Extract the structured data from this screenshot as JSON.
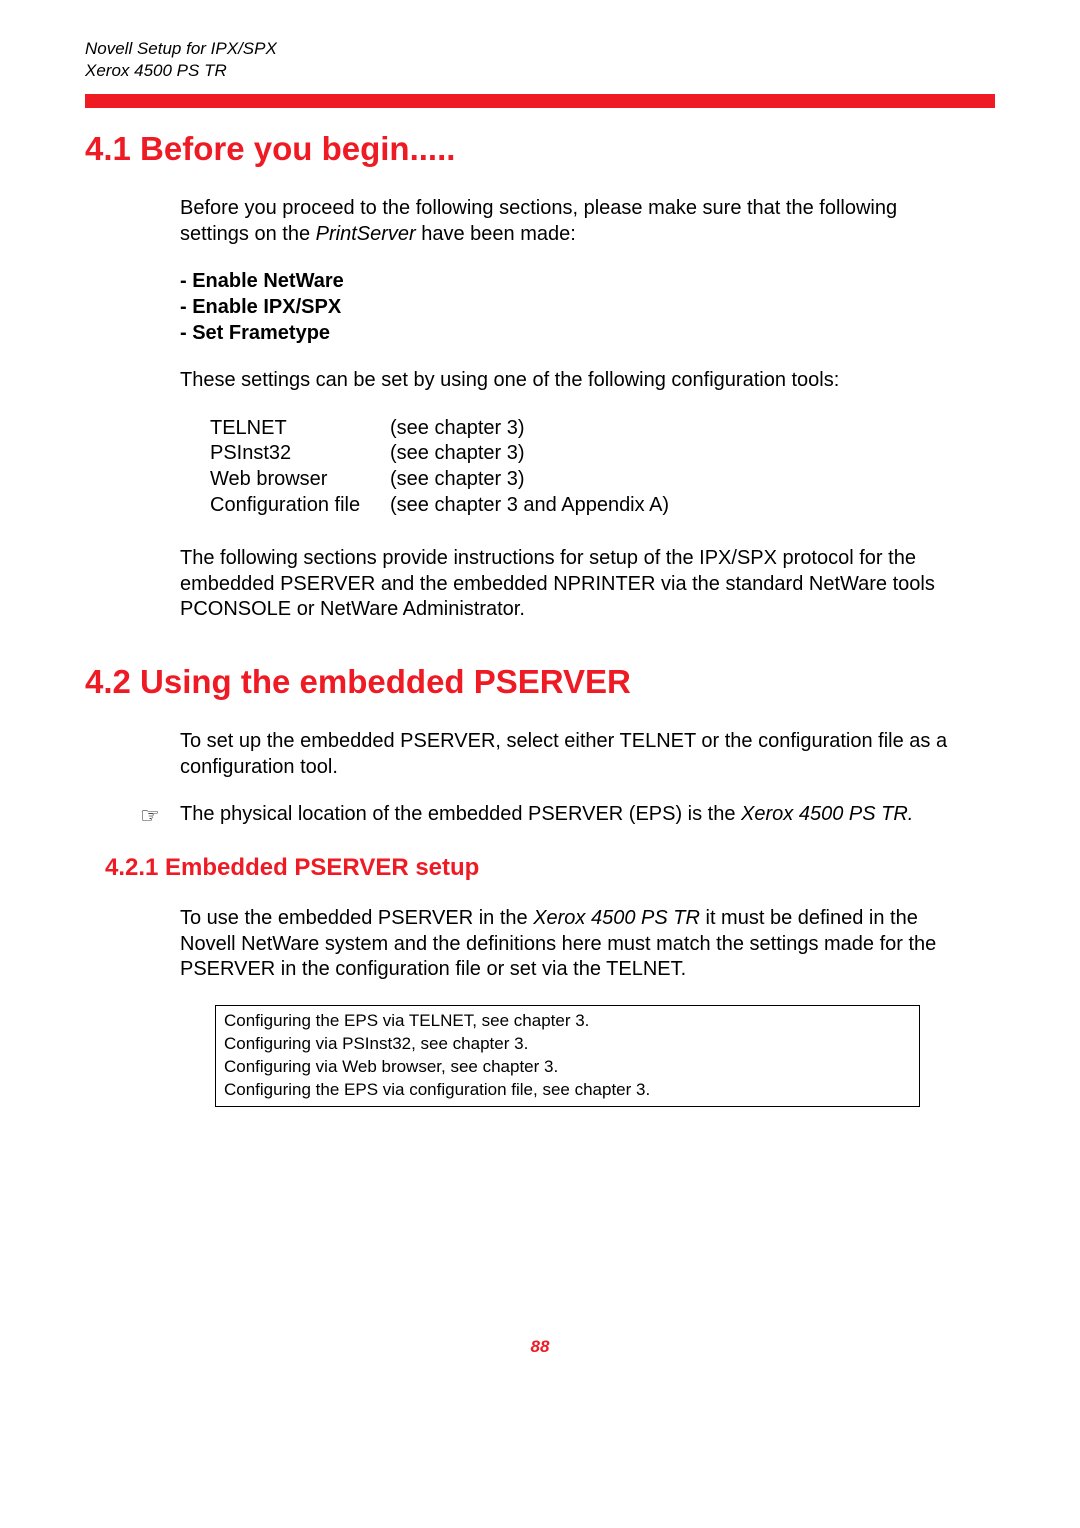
{
  "header": {
    "line1": "Novell Setup for IPX/SPX",
    "line2": "Xerox 4500 PS TR"
  },
  "sec41": {
    "title": "4.1 Before you begin.....",
    "intro_a": "Before you proceed to the following sections, please make sure that the following settings on the ",
    "intro_em": "PrintServer",
    "intro_b": " have been made:",
    "bullets": {
      "b1": "- Enable NetWare",
      "b2": "- Enable IPX/SPX",
      "b3": "- Set Frametype"
    },
    "tools_intro": "These settings can be set by using one of the following configuration tools:",
    "tools": [
      {
        "name": "TELNET",
        "ref": "(see chapter 3)"
      },
      {
        "name": "PSInst32",
        "ref": "(see chapter 3)"
      },
      {
        "name": "Web browser",
        "ref": "(see chapter 3)"
      },
      {
        "name": "Configuration file",
        "ref": "(see chapter 3 and Appendix A)"
      }
    ],
    "closing": "The following sections provide instructions for setup of the IPX/SPX protocol for the embedded PSERVER and the embedded NPRINTER via the standard NetWare tools PCONSOLE or NetWare Administrator."
  },
  "sec42": {
    "title": "4.2 Using the embedded PSERVER",
    "p1": "To set up the embedded PSERVER, select either TELNET or the configuration file as a configuration tool.",
    "note_a": "The physical location of the embedded PSERVER (EPS) is the ",
    "note_em": "Xerox 4500 PS TR",
    "note_b": "."
  },
  "sec421": {
    "title": "4.2.1 Embedded PSERVER setup",
    "p_a": "To use the embedded PSERVER in the ",
    "p_em": "Xerox 4500 PS TR",
    "p_b": " it must be defined in the Novell NetWare system and the definitions here must match the settings made for the PSERVER in the configuration file or set via the TELNET.",
    "box": {
      "l1": "Configuring the EPS via TELNET, see chapter 3.",
      "l2": "Configuring via PSInst32, see chapter 3.",
      "l3": "Configuring via Web browser, see chapter 3.",
      "l4": "Configuring the EPS via configuration file, see chapter 3."
    }
  },
  "page_number": "88",
  "icons": {
    "hand": "☞"
  }
}
